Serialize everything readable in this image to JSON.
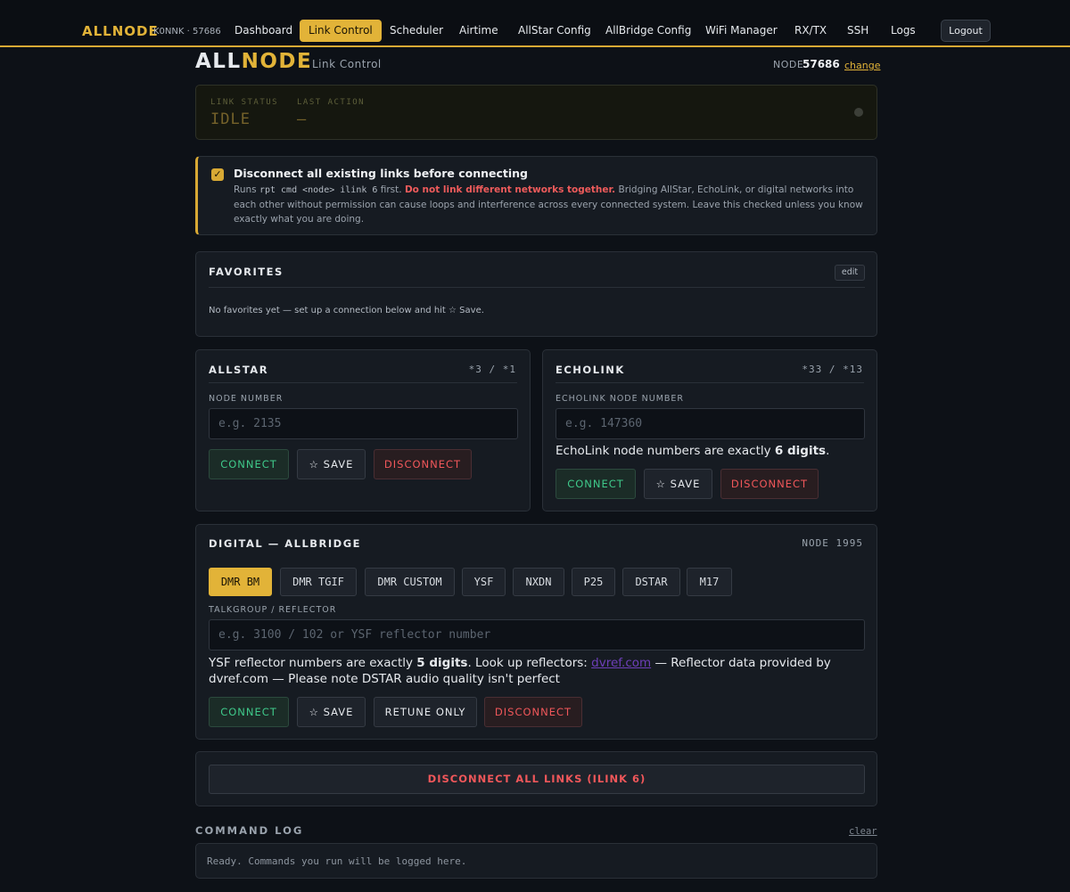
{
  "nav": {
    "brand": "ALLNODE",
    "brand_sub": "K0NNK · 57686",
    "items": [
      {
        "label": "Dashboard",
        "active": false
      },
      {
        "label": "Link Control",
        "active": true
      },
      {
        "label": "Scheduler",
        "active": false
      },
      {
        "label": "Airtime",
        "active": false
      },
      {
        "label": "AllStar Config",
        "active": false
      },
      {
        "label": "AllBridge Config",
        "active": false
      },
      {
        "label": "WiFi Manager",
        "active": false
      },
      {
        "label": "RX/TX",
        "active": false
      },
      {
        "label": "SSH",
        "active": false
      },
      {
        "label": "Logs",
        "active": false
      }
    ],
    "logout": "Logout"
  },
  "header": {
    "logo_all": "ALL",
    "logo_node": "NODE",
    "subtitle": "Link Control",
    "node_label": "NODE",
    "node_number": "57686",
    "change_link": "change"
  },
  "status": {
    "link_status_label": "LINK STATUS",
    "link_status_value": "IDLE",
    "last_action_label": "LAST ACTION",
    "last_action_value": "—"
  },
  "warning": {
    "checked": true,
    "check_mark": "✓",
    "title": "Disconnect all existing links before connecting",
    "body_prefix": "Runs ",
    "body_code": "rpt cmd <node> ilink 6",
    "body_mid": " first. ",
    "body_danger": "Do not link different networks together.",
    "body_suffix": " Bridging AllStar, EchoLink, or digital networks into each other without permission can cause loops and interference across every connected system. Leave this checked unless you know exactly what you are doing."
  },
  "favorites": {
    "title": "FAVORITES",
    "edit": "edit",
    "empty": "No favorites yet — set up a connection below and hit ☆ Save."
  },
  "allstar": {
    "title": "ALLSTAR",
    "codes": "*3 / *1",
    "field_label": "NODE NUMBER",
    "placeholder": "e.g. 2135",
    "connect": "CONNECT",
    "save": "☆ SAVE",
    "disconnect": "DISCONNECT"
  },
  "echolink": {
    "title": "ECHOLINK",
    "codes": "*33 / *13",
    "field_label": "ECHOLINK NODE NUMBER",
    "placeholder": "e.g. 147360",
    "help_prefix": "EchoLink node numbers are exactly ",
    "help_bold": "6 digits",
    "help_suffix": ".",
    "connect": "CONNECT",
    "save": "☆ SAVE",
    "disconnect": "DISCONNECT"
  },
  "digital": {
    "title": "DIGITAL — ALLBRIDGE",
    "node": "NODE 1995",
    "modes": [
      {
        "label": "DMR BM",
        "active": true
      },
      {
        "label": "DMR TGIF",
        "active": false
      },
      {
        "label": "DMR CUSTOM",
        "active": false
      },
      {
        "label": "YSF",
        "active": false
      },
      {
        "label": "NXDN",
        "active": false
      },
      {
        "label": "P25",
        "active": false
      },
      {
        "label": "DSTAR",
        "active": false
      },
      {
        "label": "M17",
        "active": false
      }
    ],
    "field_label": "TALKGROUP / REFLECTOR",
    "placeholder": "e.g. 3100 / 102 or YSF reflector number",
    "help_prefix": "YSF reflector numbers are exactly ",
    "help_bold": "5 digits",
    "help_mid": ". Look up reflectors: ",
    "help_link": "dvref.com",
    "help_suffix": " — Reflector data provided by dvref.com — Please note DSTAR audio quality isn't perfect",
    "connect": "CONNECT",
    "save": "☆ SAVE",
    "retune": "RETUNE ONLY",
    "disconnect": "DISCONNECT"
  },
  "disconnect_all": "DISCONNECT ALL LINKS (ILINK 6)",
  "command_log": {
    "title": "COMMAND LOG",
    "clear": "clear",
    "text": "Ready. Commands you run will be logged here."
  },
  "colors": {
    "accent": "#e2b338",
    "background": "#0d1117",
    "panel": "#161b22",
    "connect": "#3fc98a",
    "disconnect": "#f0575a"
  }
}
